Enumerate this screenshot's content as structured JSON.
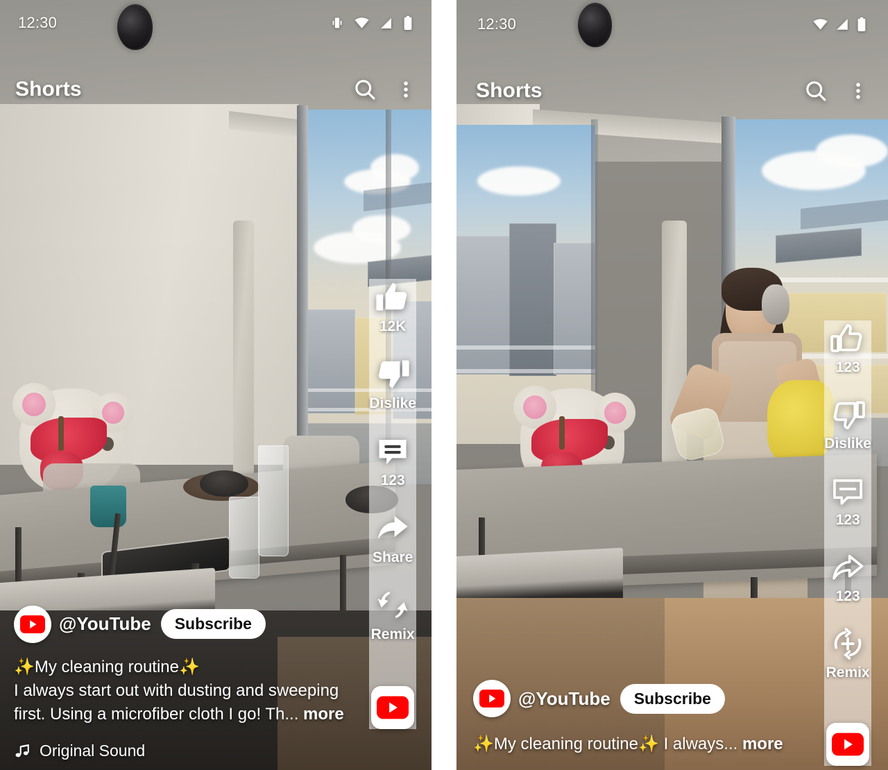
{
  "panels": [
    {
      "id": "left-shorts-player",
      "status_bar": {
        "time": "12:30",
        "icons": [
          "vibrate-icon",
          "wifi-icon",
          "cellular-signal-icon",
          "battery-icon"
        ]
      },
      "top_bar": {
        "title": "Shorts",
        "search_icon": "search-icon",
        "more_icon": "more-vertical-icon"
      },
      "actions": [
        {
          "icon": "thumbs-up-filled-icon",
          "label": "12K",
          "name": "like-button"
        },
        {
          "icon": "thumbs-down-filled-icon",
          "label": "Dislike",
          "name": "dislike-button"
        },
        {
          "icon": "comment-filled-icon",
          "label": "123",
          "name": "comment-button"
        },
        {
          "icon": "share-filled-icon",
          "label": "Share",
          "name": "share-button"
        },
        {
          "icon": "remix-arrows-icon",
          "label": "Remix",
          "name": "remix-button"
        }
      ],
      "app_chip": {
        "icon": "youtube-logo-icon",
        "name": "youtube-app-chip"
      },
      "channel": {
        "avatar_icon": "youtube-logo-icon",
        "handle": "@YouTube",
        "subscribe_label": "Subscribe"
      },
      "caption": {
        "line1_prefix": "✨",
        "line1_text": "My cleaning routine",
        "line1_suffix": "✨",
        "line2": "I always start out with dusting and sweeping",
        "line3": "first. Using a microfiber cloth I go! Th...",
        "more_label": "more"
      },
      "sound": {
        "icon": "music-note-icon",
        "label": "Original Sound"
      }
    },
    {
      "id": "right-shorts-player",
      "status_bar": {
        "time": "12:30",
        "icons": [
          "wifi-icon",
          "cellular-signal-icon",
          "battery-icon"
        ]
      },
      "top_bar": {
        "title": "Shorts",
        "search_icon": "search-icon",
        "more_icon": "more-vertical-icon"
      },
      "actions": [
        {
          "icon": "thumbs-up-outline-icon",
          "label": "123",
          "name": "like-button"
        },
        {
          "icon": "thumbs-down-outline-icon",
          "label": "Dislike",
          "name": "dislike-button"
        },
        {
          "icon": "comment-outline-icon",
          "label": "123",
          "name": "comment-button"
        },
        {
          "icon": "share-outline-icon",
          "label": "123",
          "name": "share-button"
        },
        {
          "icon": "remix-circle-plus-icon",
          "label": "Remix",
          "name": "remix-button"
        }
      ],
      "app_chip": {
        "icon": "youtube-logo-icon",
        "name": "youtube-app-chip"
      },
      "channel": {
        "avatar_icon": "youtube-logo-icon",
        "handle": "@YouTube",
        "subscribe_label": "Subscribe"
      },
      "caption": {
        "line1_prefix": "✨",
        "line1_text": "My cleaning routine",
        "line1_suffix": "✨",
        "line2": "I always...",
        "more_label": "more"
      }
    }
  ],
  "colors": {
    "youtube_red": "#FF0000",
    "overlay_text": "#FFFFFF",
    "chip_background": "#FFFFFF",
    "subscribe_text": "#0F0F0F",
    "sparkle_yellow": "#FFD84D"
  }
}
